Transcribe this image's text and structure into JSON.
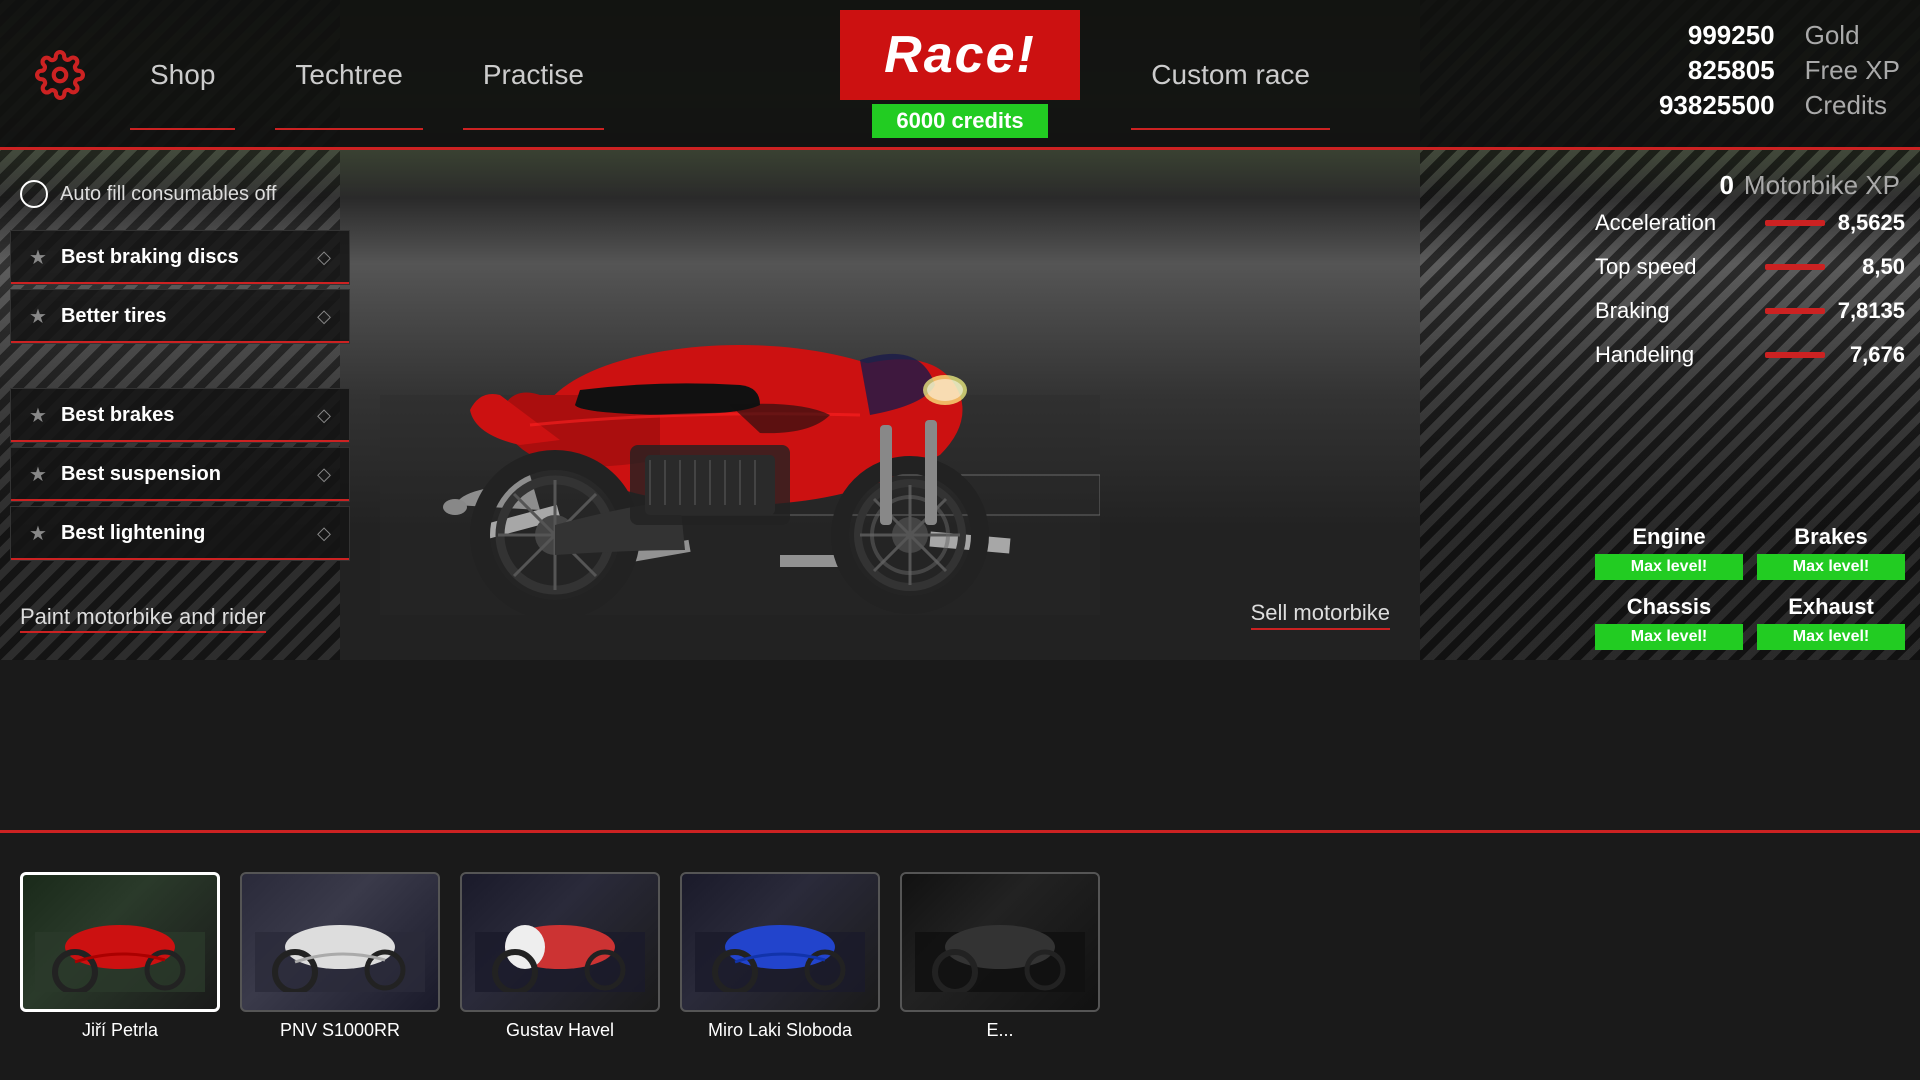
{
  "header": {
    "gear_icon": "⚙",
    "nav": {
      "shop": "Shop",
      "techtree": "Techtree",
      "practise": "Practise",
      "custom_race": "Custom race"
    },
    "race_button": "Race!",
    "credits_badge": "6000 credits",
    "stats": {
      "gold_value": "999250",
      "gold_label": "Gold",
      "free_xp_value": "825805",
      "free_xp_label": "Free XP",
      "credits_value": "93825500",
      "credits_label": "Credits"
    }
  },
  "main": {
    "auto_fill": "Auto fill consumables off",
    "motorbike_xp": {
      "value": "0",
      "label": "Motorbike XP"
    },
    "upgrades": {
      "group1": [
        {
          "label": "Best braking discs"
        },
        {
          "label": "Better tires"
        }
      ],
      "group2": [
        {
          "label": "Best brakes"
        },
        {
          "label": "Best suspension"
        },
        {
          "label": "Best lightening"
        }
      ]
    },
    "stats": [
      {
        "name": "Acceleration",
        "value": "8,5625"
      },
      {
        "name": "Top speed",
        "value": "8,50"
      },
      {
        "name": "Braking",
        "value": "7,8135"
      },
      {
        "name": "Handeling",
        "value": "7,676"
      }
    ],
    "components": [
      {
        "title": "Engine",
        "badge": "Max level!"
      },
      {
        "title": "Brakes",
        "badge": "Max level!"
      },
      {
        "title": "Chassis",
        "badge": "Max level!"
      },
      {
        "title": "Exhaust",
        "badge": "Max level!"
      }
    ],
    "paint_link": "Paint motorbike and rider",
    "sell_link": "Sell motorbike"
  },
  "gallery": {
    "items": [
      {
        "name": "Jiří Petrla",
        "color": "red",
        "active": true
      },
      {
        "name": "PNV S1000RR",
        "color": "white",
        "active": false
      },
      {
        "name": "Gustav Havel",
        "color": "red2",
        "active": false
      },
      {
        "name": "Miro Laki Sloboda",
        "color": "blue",
        "active": false
      },
      {
        "name": "E...",
        "color": "dark",
        "active": false
      }
    ]
  }
}
